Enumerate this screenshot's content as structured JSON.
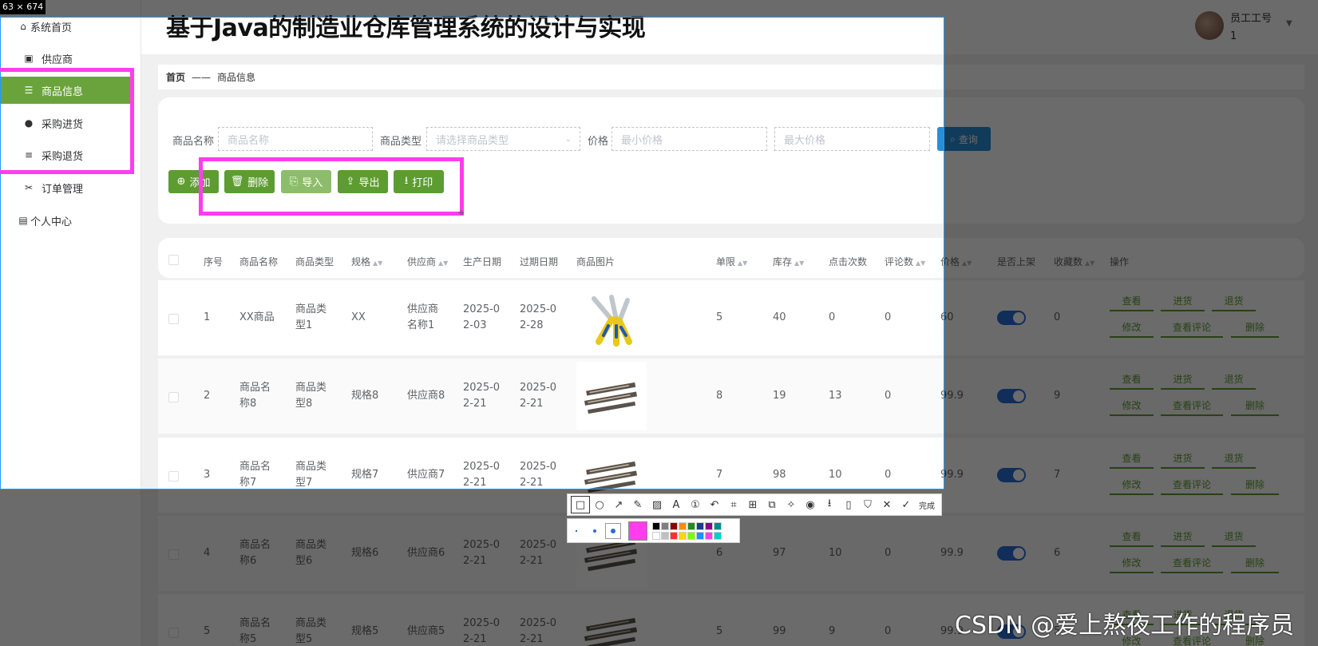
{
  "sidebar": {
    "items": [
      {
        "label": "系统首页",
        "icon": "home-icon"
      },
      {
        "label": "供应商",
        "icon": "clipboard-icon"
      },
      {
        "label": "商品信息",
        "icon": "sliders-icon"
      },
      {
        "label": "采购进货",
        "icon": "pin-icon"
      },
      {
        "label": "采购退货",
        "icon": "list-icon"
      },
      {
        "label": "订单管理",
        "icon": "ticket-icon"
      },
      {
        "label": "个人中心",
        "icon": "card-icon"
      }
    ]
  },
  "header": {
    "title": "基于Java的制造业仓库管理系统的设计与实现"
  },
  "user": {
    "role": "员工工号",
    "id": "1"
  },
  "breadcrumb": {
    "home": "首页",
    "separator": "——",
    "current": "商品信息"
  },
  "filters": {
    "name_label": "商品名称",
    "name_placeholder": "商品名称",
    "type_label": "商品类型",
    "type_placeholder": "请选择商品类型",
    "price_label": "价格",
    "min_placeholder": "最小价格",
    "max_placeholder": "最大价格",
    "search_label": "查询"
  },
  "actions": {
    "add": "添加",
    "delete": "删除",
    "import": "导入",
    "export": "导出",
    "print": "打印"
  },
  "table": {
    "headers": [
      "序号",
      "商品名称",
      "商品类型",
      "规格",
      "供应商",
      "生产日期",
      "过期日期",
      "商品图片",
      "单限",
      "库存",
      "点击次数",
      "评论数",
      "价格",
      "是否上架",
      "收藏数",
      "操作"
    ],
    "rows": [
      {
        "no": "1",
        "name": "XX商品",
        "type": "商品类型1",
        "spec": "XX",
        "supplier": "供应商名称1",
        "prod": "2025-02-03",
        "exp": "2025-02-28",
        "limit": "5",
        "stock": "40",
        "clicks": "0",
        "comments": "0",
        "price": "60",
        "favs": "0"
      },
      {
        "no": "2",
        "name": "商品名称8",
        "type": "商品类型8",
        "spec": "规格8",
        "supplier": "供应商8",
        "prod": "2025-02-21",
        "exp": "2025-02-21",
        "limit": "8",
        "stock": "19",
        "clicks": "13",
        "comments": "0",
        "price": "99.9",
        "favs": "9"
      },
      {
        "no": "3",
        "name": "商品名称7",
        "type": "商品类型7",
        "spec": "规格7",
        "supplier": "供应商7",
        "prod": "2025-02-21",
        "exp": "2025-02-21",
        "limit": "7",
        "stock": "98",
        "clicks": "10",
        "comments": "0",
        "price": "99.9",
        "favs": "7"
      },
      {
        "no": "4",
        "name": "商品名称6",
        "type": "商品类型6",
        "spec": "规格6",
        "supplier": "供应商6",
        "prod": "2025-02-21",
        "exp": "2025-02-21",
        "limit": "6",
        "stock": "97",
        "clicks": "10",
        "comments": "0",
        "price": "99.9",
        "favs": "6"
      },
      {
        "no": "5",
        "name": "商品名称5",
        "type": "商品类型5",
        "spec": "规格5",
        "supplier": "供应商5",
        "prod": "2025-02-21",
        "exp": "2025-02-21",
        "limit": "5",
        "stock": "99",
        "clicks": "9",
        "comments": "0",
        "price": "99.9",
        "favs": "5"
      }
    ],
    "ops": {
      "view": "查看",
      "stock_in": "进货",
      "return": "退货",
      "edit": "修改",
      "view_comments": "查看评论",
      "delete": "删除"
    }
  },
  "screenshot_tool": {
    "size_label": "63 × 674",
    "done_label": "完成",
    "pen_color": "#ff3dee"
  },
  "watermark": "CSDN @爱上熬夜工作的程序员",
  "colors": {
    "accent": "#5d9c31",
    "search": "#2a8ed6",
    "toggle": "#2a6cd6",
    "highlight": "#ff3dee",
    "selection": "#1e9bff"
  }
}
